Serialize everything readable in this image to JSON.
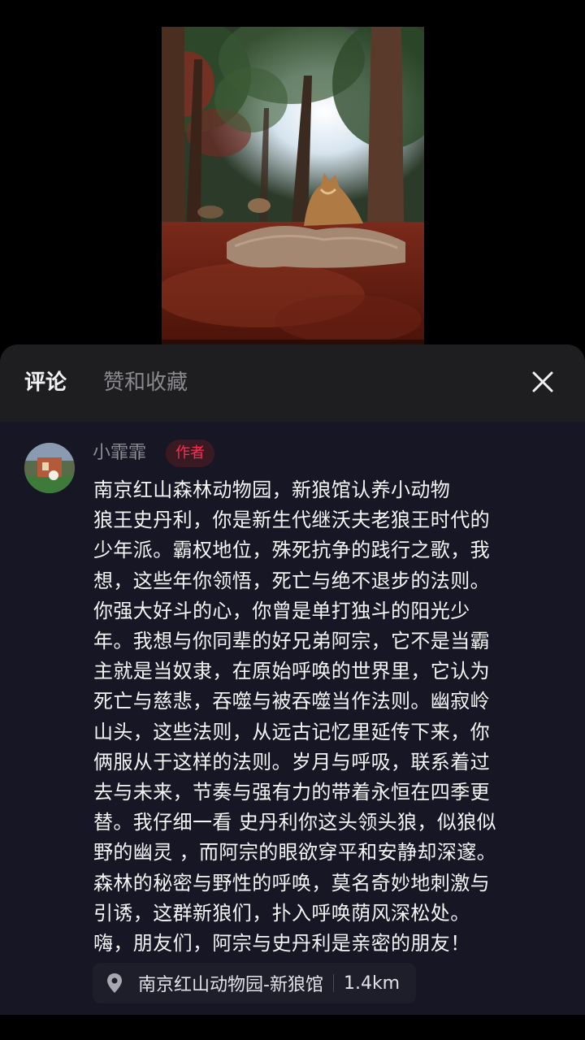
{
  "tabs": {
    "comments": "评论",
    "likes_and_favorites": "赞和收藏"
  },
  "icons": {
    "close": "close-icon",
    "location": "location-pin-icon"
  },
  "comment": {
    "username": "小霏霏",
    "badge": "作者",
    "lines": [
      "南京红山森林动物园，新狼馆认养小动物",
      "狼王史丹利，你是新生代继沃夫老狼王时代的",
      "少年派。霸权地位，殊死抗争的践行之歌，我",
      "想，这些年你领悟，死亡与绝不退步的法则。",
      "你强大好斗的心，你曾是单打独斗的阳光少",
      "年。我想与你同辈的好兄弟阿宗，它不是当霸",
      "主就是当奴隶，在原始呼唤的世界里，它认为",
      "死亡与慈悲，吞噬与被吞噬当作法则。幽寂岭",
      "山头，这些法则，从远古记忆里延传下来，你",
      "俩服从于这样的法则。岁月与呼吸，联系着过",
      "去与未来，节奏与强有力的带着永恒在四季更",
      "替。我仔细一看 史丹利你这头领头狼，似狼似",
      "野的幽灵 ，而阿宗的眼欲穿平和安静却深邃。",
      "森林的秘密与野性的呼唤，莫名奇妙地刺激与",
      "引诱，这群新狼们，扑入呼唤荫风深松处。",
      "嗨，朋友们，阿宗与史丹利是亲密的朋友！"
    ]
  },
  "location": {
    "name": "南京红山动物园-新狼馆",
    "distance": "1.4km"
  },
  "colors": {
    "author_badge_text": "#fe2c55",
    "sheet_background": "#1c1c1f",
    "body_background": "#161624"
  }
}
